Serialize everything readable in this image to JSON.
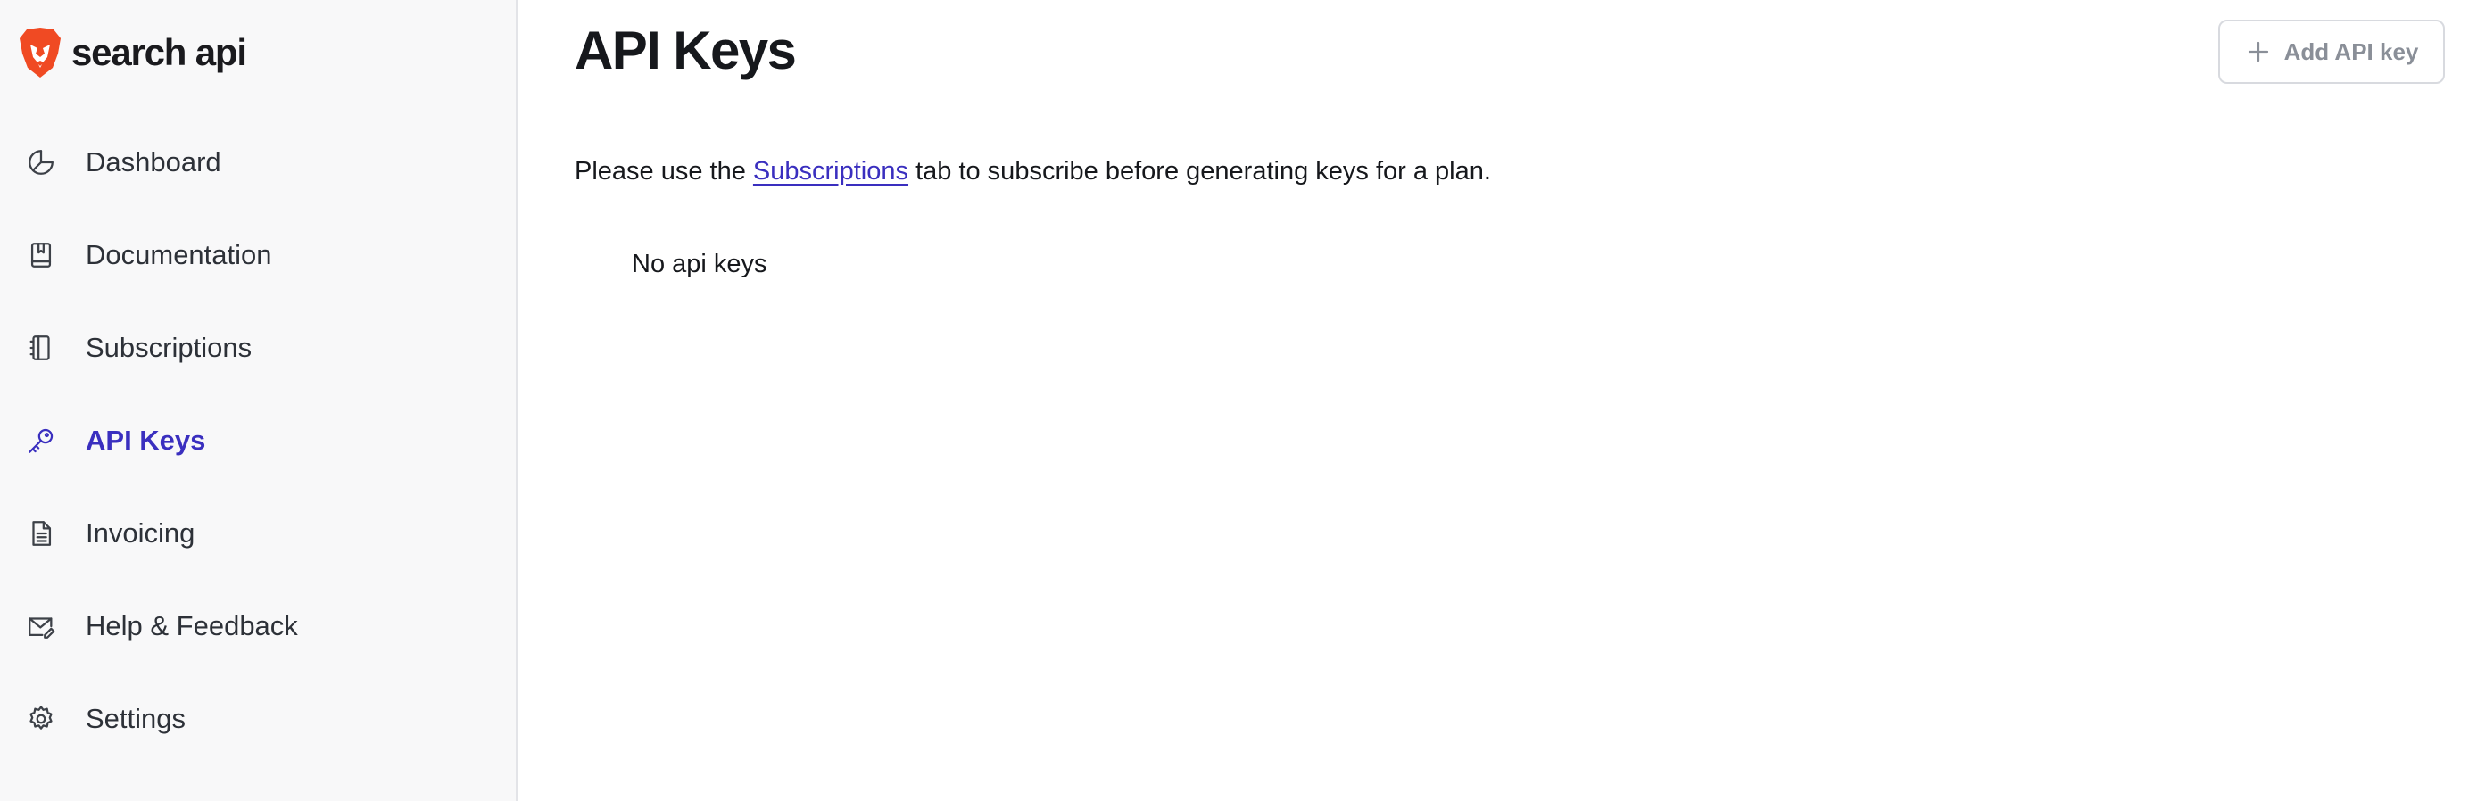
{
  "brand": {
    "name": "search api",
    "logo_icon": "lion-logo-icon",
    "logo_color": "#f04a23"
  },
  "sidebar": {
    "items": [
      {
        "label": "Dashboard",
        "icon": "pie-chart-icon",
        "active": false
      },
      {
        "label": "Documentation",
        "icon": "book-icon",
        "active": false
      },
      {
        "label": "Subscriptions",
        "icon": "notebook-icon",
        "active": false
      },
      {
        "label": "API Keys",
        "icon": "key-icon",
        "active": true
      },
      {
        "label": "Invoicing",
        "icon": "document-icon",
        "active": false
      },
      {
        "label": "Help & Feedback",
        "icon": "mail-icon",
        "active": false
      },
      {
        "label": "Settings",
        "icon": "gear-icon",
        "active": false
      }
    ],
    "active_color": "#3a2fbf"
  },
  "main": {
    "title": "API Keys",
    "add_button": {
      "label": "Add API key",
      "icon": "plus-icon"
    },
    "notice": {
      "before": "Please use the ",
      "link": "Subscriptions",
      "after": " tab to subscribe before generating keys for a plan."
    },
    "empty_state": "No api keys"
  }
}
